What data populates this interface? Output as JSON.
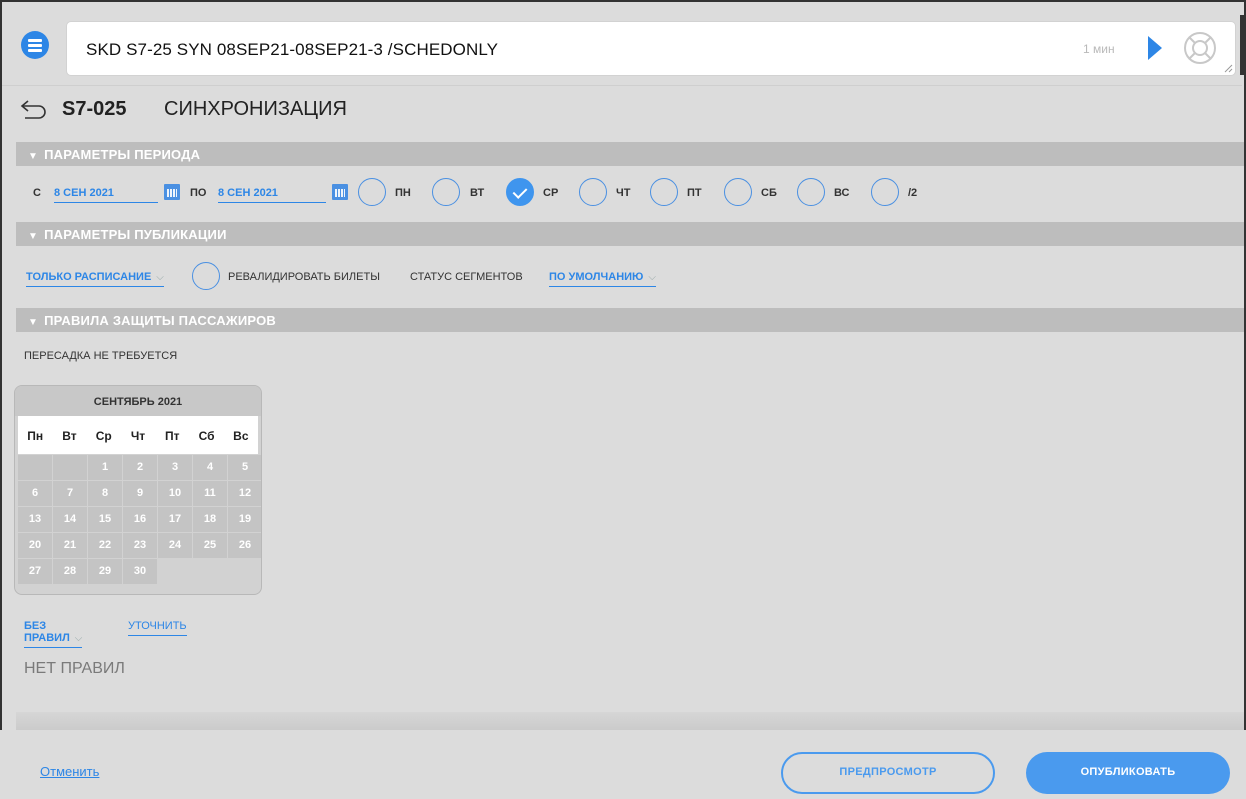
{
  "command": {
    "text": "SKD S7-25 SYN 08SEP21-08SEP21-3 /SCHEDONLY",
    "time": "1 мин"
  },
  "header": {
    "flight": "S7-025",
    "title": "СИНХРОНИЗАЦИЯ"
  },
  "sections": {
    "period": "ПАРАМЕТРЫ ПЕРИОДА",
    "publication": "ПАРАМЕТРЫ ПУБЛИКАЦИИ",
    "protection": "ПРАВИЛА ЗАЩИТЫ ПАССАЖИРОВ"
  },
  "period": {
    "from_label": "С",
    "from_date": "8 СЕН 2021",
    "to_label": "ПО",
    "to_date": "8 СЕН 2021",
    "days": [
      {
        "label": "ПН",
        "checked": false
      },
      {
        "label": "ВТ",
        "checked": false
      },
      {
        "label": "СР",
        "checked": true
      },
      {
        "label": "ЧТ",
        "checked": false
      },
      {
        "label": "ПТ",
        "checked": false
      },
      {
        "label": "СБ",
        "checked": false
      },
      {
        "label": "ВС",
        "checked": false
      },
      {
        "label": "/2",
        "checked": false
      }
    ]
  },
  "publication": {
    "mode": "ТОЛЬКО РАСПИСАНИЕ",
    "revalidate": "РЕВАЛИДИРОВАТЬ БИЛЕТЫ",
    "segment_status_label": "СТАТУС СЕГМЕНТОВ",
    "segment_status_value": "ПО УМОЛЧАНИЮ"
  },
  "protection": {
    "transfer": "ПЕРЕСАДКА НЕ ТРЕБУЕТСЯ",
    "calendar_month": "СЕНТЯБРЬ 2021",
    "weekdays": [
      "Пн",
      "Вт",
      "Ср",
      "Чт",
      "Пт",
      "Сб",
      "Вс"
    ],
    "rules_dropdown": "БЕЗ ПРАВИЛ",
    "refine_link": "УТОЧНИТЬ",
    "no_rules": "НЕТ ПРАВИЛ"
  },
  "footer": {
    "cancel": "Отменить",
    "preview": "ПРЕДПРОСМОТР",
    "publish": "ОПУБЛИКОВАТЬ"
  },
  "colors": {
    "accent": "#2d86e6",
    "background": "#dcdcdc",
    "section_header": "#bdbdbd"
  }
}
